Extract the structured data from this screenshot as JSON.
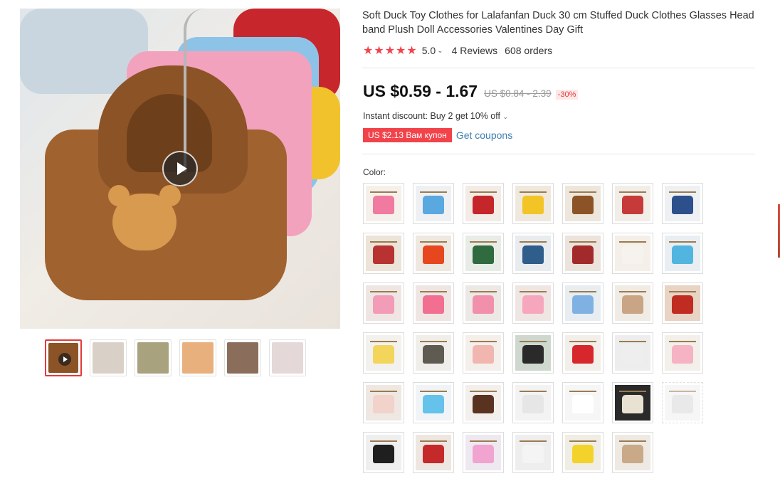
{
  "product": {
    "title": "Soft Duck Toy Clothes for Lalafanfan Duck 30 cm Stuffed Duck Clothes Glasses Head band Plush Doll Accessories Valentines Day Gift",
    "rating": "5.0",
    "stars": "★★★★★",
    "reviews": "4 Reviews",
    "orders": "608 orders",
    "price": "US $0.59 - 1.67",
    "original_price": "US $0.84 - 2.39",
    "discount": "-30%",
    "instant_discount": "Instant discount: Buy 2 get 10% off",
    "coupon": "US $2.13 Вам купон",
    "get_coupons": "Get coupons",
    "color_label": "Color:"
  },
  "gallery": {
    "thumbnails": [
      {
        "color": "#8c5326",
        "video": true,
        "active": true
      },
      {
        "color": "#d9d0c8"
      },
      {
        "color": "#a9a27f"
      },
      {
        "color": "#e7b07c"
      },
      {
        "color": "#8a6d5a"
      },
      {
        "color": "#e5d8d8"
      }
    ]
  },
  "colors": [
    {
      "bg": "#f5f0ea",
      "shirt": "#f07aa0"
    },
    {
      "bg": "#eef0f3",
      "shirt": "#5aa8e0"
    },
    {
      "bg": "#f3ece6",
      "shirt": "#c4262a"
    },
    {
      "bg": "#efe8dd",
      "shirt": "#f3c425"
    },
    {
      "bg": "#ede6dc",
      "shirt": "#8c5326"
    },
    {
      "bg": "#f1ede7",
      "shirt": "#c73a3a"
    },
    {
      "bg": "#eef0f3",
      "shirt": "#2d4f8c"
    },
    {
      "bg": "#ece4d8",
      "shirt": "#b83232"
    },
    {
      "bg": "#eee8e0",
      "shirt": "#e6471f"
    },
    {
      "bg": "#e8ece6",
      "shirt": "#2f6b3f"
    },
    {
      "bg": "#e8ecef",
      "shirt": "#2f5d8c"
    },
    {
      "bg": "#ece4dc",
      "shirt": "#a32a2a"
    },
    {
      "bg": "#f4efe8",
      "shirt": "#f6f2ee"
    },
    {
      "bg": "#e9eef2",
      "shirt": "#52b5e0"
    },
    {
      "bg": "#efe6e4",
      "shirt": "#f29cb8"
    },
    {
      "bg": "#efe6e4",
      "shirt": "#f26f92"
    },
    {
      "bg": "#ece8e6",
      "shirt": "#f290ac"
    },
    {
      "bg": "#efe6e4",
      "shirt": "#f6a7bd"
    },
    {
      "bg": "#e8edf1",
      "shirt": "#7fb2e3"
    },
    {
      "bg": "#f0ebe4",
      "shirt": "#c9a585"
    },
    {
      "bg": "#e8d3c4",
      "shirt": "#c02b22"
    },
    {
      "bg": "#f3f1ee",
      "shirt": "#f2d55a"
    },
    {
      "bg": "#f0eeea",
      "shirt": "#5f5b52"
    },
    {
      "bg": "#f4efea",
      "shirt": "#f2b6b0"
    },
    {
      "bg": "#cfd8cf",
      "shirt": "#2a2a2a"
    },
    {
      "bg": "#f2eee9",
      "shirt": "#d8262d"
    },
    {
      "bg": "#ededed",
      "shirt": "#eeeeee"
    },
    {
      "bg": "#f3efea",
      "shirt": "#f6b3c4"
    },
    {
      "bg": "#efe8e2",
      "shirt": "#f1d3cb"
    },
    {
      "bg": "#f1f4f6",
      "shirt": "#65c2eb"
    },
    {
      "bg": "#f2efec",
      "shirt": "#5a3320"
    },
    {
      "bg": "#f3f3f3",
      "shirt": "#e6e6e6"
    },
    {
      "bg": "#f6f6f6",
      "shirt": "#ffffff"
    },
    {
      "bg": "#2a2a2a",
      "shirt": "#e9e2d2"
    },
    {
      "bg": "#f0f0f0",
      "shirt": "#d8d8d8",
      "disabled": true
    },
    {
      "bg": "#efefef",
      "shirt": "#1f1f1f"
    },
    {
      "bg": "#eee6e0",
      "shirt": "#c52a2a"
    },
    {
      "bg": "#eee8f0",
      "shirt": "#f0a4cf"
    },
    {
      "bg": "#eeeeee",
      "shirt": "#f4f4f4"
    },
    {
      "bg": "#f0ede4",
      "shirt": "#f3d32b"
    },
    {
      "bg": "#eee9e3",
      "shirt": "#c9a988"
    }
  ]
}
